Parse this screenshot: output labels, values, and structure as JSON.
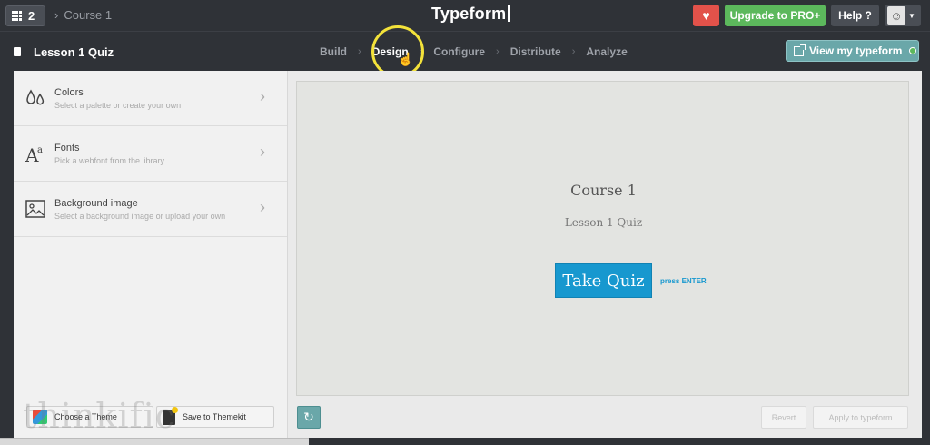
{
  "topbar": {
    "workspace_count": "2",
    "breadcrumb": "Course 1",
    "brand": "Typeform",
    "upgrade_label": "Upgrade to PRO+",
    "help_label": "Help ?"
  },
  "subbar": {
    "form_title": "Lesson 1 Quiz",
    "steps": [
      {
        "label": "Build"
      },
      {
        "label": "Design"
      },
      {
        "label": "Configure"
      },
      {
        "label": "Distribute"
      },
      {
        "label": "Analyze"
      }
    ],
    "active_step": "Design",
    "view_label": "View my typeform"
  },
  "design_menu": {
    "items": [
      {
        "label": "Colors",
        "description": "Select a palette or create your own",
        "icon": "drops-icon"
      },
      {
        "label": "Fonts",
        "description": "Pick a webfont from the library",
        "icon": "font-icon"
      },
      {
        "label": "Background image",
        "description": "Select a background image or upload your own",
        "icon": "image-icon"
      }
    ],
    "choose_theme_label": "Choose a Theme",
    "save_themekit_label": "Save to Themekit"
  },
  "watermark": "thinkific",
  "preview": {
    "title": "Course 1",
    "subtitle": "Lesson 1 Quiz",
    "button_label": "Take Quiz",
    "hint": "press ENTER"
  },
  "actions": {
    "revert_label": "Revert",
    "apply_label": "Apply to typeform"
  },
  "colors": {
    "accent": "#1798cf",
    "teal": "#6aa7a9",
    "pro_green": "#5cb85c",
    "heart_red": "#e2524a"
  }
}
